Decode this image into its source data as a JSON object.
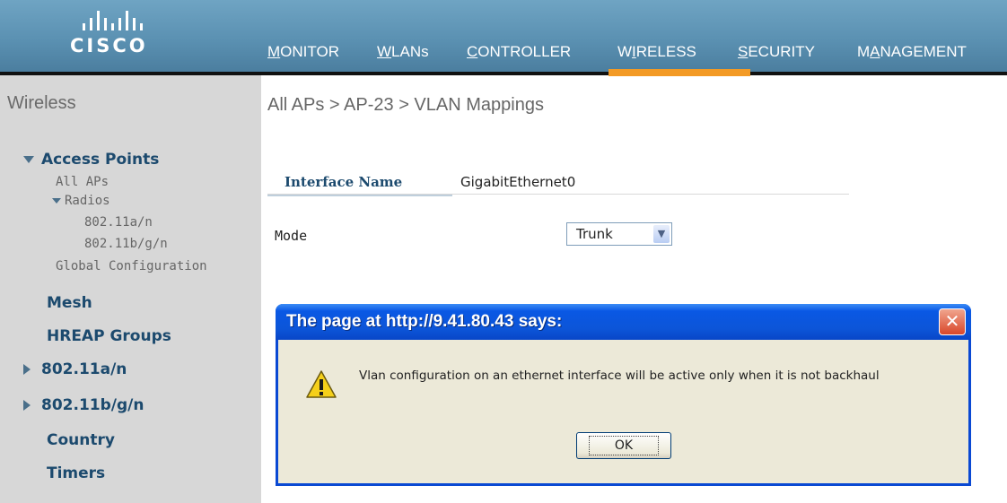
{
  "header": {
    "logo_text": "CISCO",
    "nav": [
      {
        "pre": "",
        "ul": "M",
        "post": "ONITOR",
        "active": false
      },
      {
        "pre": "",
        "ul": "W",
        "post": "LANs",
        "active": false
      },
      {
        "pre": "",
        "ul": "C",
        "post": "ONTROLLER",
        "active": false
      },
      {
        "pre": "W",
        "ul": "I",
        "post": "RELESS",
        "active": true
      },
      {
        "pre": "",
        "ul": "S",
        "post": "ECURITY",
        "active": false
      },
      {
        "pre": "M",
        "ul": "A",
        "post": "NAGEMENT",
        "active": false
      }
    ]
  },
  "sidebar": {
    "title": "Wireless",
    "access_points": "Access Points",
    "all_aps": "All APs",
    "radios": "Radios",
    "radio_a": "802.11a/n",
    "radio_bg": "802.11b/g/n",
    "global_config": "Global Configuration",
    "mesh": "Mesh",
    "hreap": "HREAP Groups",
    "band_a": "802.11a/n",
    "band_bg": "802.11b/g/n",
    "country": "Country",
    "timers": "Timers"
  },
  "main": {
    "breadcrumb": "All APs > AP-23 > VLAN Mappings",
    "interface_label": "Interface Name",
    "interface_value": "GigabitEthernet0",
    "mode_label": "Mode",
    "mode_value": "Trunk"
  },
  "dialog": {
    "title": "The page at http://9.41.80.43 says:",
    "message": "Vlan configuration on an ethernet interface will be active only when it is not backhaul",
    "ok_label": "OK",
    "close_symbol": "✕"
  },
  "colors": {
    "header_blue": "#5b91b2",
    "active_tab": "#f39a25",
    "sidebar_bg": "#d7d7d7",
    "dialog_title_blue": "#0a58e4"
  }
}
